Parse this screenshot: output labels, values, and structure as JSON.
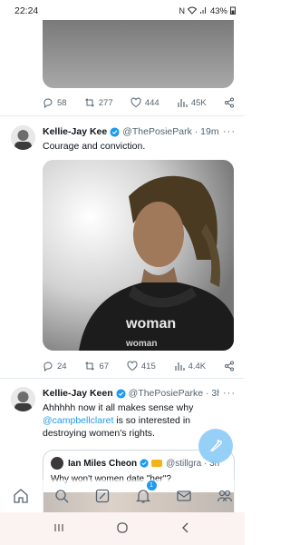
{
  "status": {
    "time": "22:24",
    "battery": "43%"
  },
  "prev_tweet": {
    "actions": {
      "replies": "58",
      "retweets": "277",
      "likes": "444",
      "views": "45K"
    }
  },
  "tweet1": {
    "name": "Kellie-Jay Kee",
    "handle": "@ThePosiePark",
    "time": "· 19m",
    "more": "···",
    "text": "Courage and conviction.",
    "photo_text_1": "woman",
    "photo_text_2": "woman",
    "actions": {
      "replies": "24",
      "retweets": "67",
      "likes": "415",
      "views": "4.4K"
    }
  },
  "tweet2": {
    "name": "Kellie-Jay Keen",
    "handle": "@ThePosiePark",
    "time": "e · 3h",
    "more": "···",
    "text_1": "Ahhhhh now it all makes sense why",
    "mention": "@campbellclaret",
    "text_2": " is so interested in destroying women's rights.",
    "quote": {
      "name": "Ian Miles Cheon",
      "handle": "@stillgra",
      "time": "· 3h",
      "text": "Why won't women date \"her\"?"
    }
  },
  "nav": {
    "notifications_badge": "1"
  },
  "colors": {
    "accent": "#1d9bf0",
    "muted": "#536471",
    "fab": "#8ecdf7"
  }
}
